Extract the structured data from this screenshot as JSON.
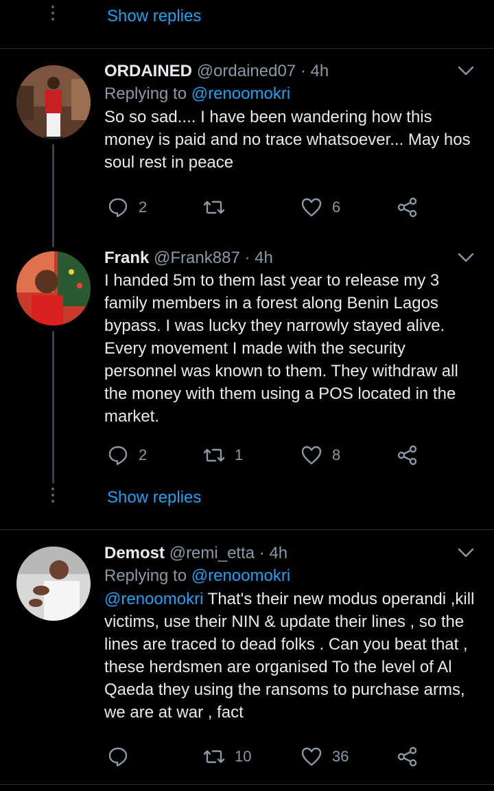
{
  "show_replies_label": "Show replies",
  "colors": {
    "accent": "#1da1f2",
    "muted": "#8b98a5",
    "background": "#000000"
  },
  "tweets": [
    {
      "name": "ORDAINED",
      "handle": "@ordained07",
      "separator": "·",
      "time": "4h",
      "replying_prefix": "Replying to",
      "replying_to": "@renoomokri",
      "text": "So so sad.... I have been wandering how this money is paid and no trace whatsoever... May hos soul rest in peace",
      "replies": "2",
      "retweets": "",
      "likes": "6"
    },
    {
      "name": "Frank",
      "handle": "@Frank887",
      "separator": "·",
      "time": "4h",
      "text": "I handed 5m to them last year to release my 3 family members in a forest along Benin Lagos bypass. I was lucky they narrowly stayed alive. Every movement I made with the security personnel was known to them. They withdraw all the money with them using a POS located in the market.",
      "replies": "2",
      "retweets": "1",
      "likes": "8"
    },
    {
      "name": "Demost",
      "handle": "@remi_etta",
      "separator": "·",
      "time": "4h",
      "replying_prefix": "Replying to",
      "replying_to": "@renoomokri",
      "mention": "@renoomokri",
      "text": " That's their new modus operandi ,kill victims, use their NIN & update their lines , so the lines are traced to dead folks . Can you beat that , these herdsmen are organised To the level of Al Qaeda  they using the ransoms to purchase arms, we are at war , fact",
      "replies": "",
      "retweets": "10",
      "likes": "36"
    }
  ]
}
